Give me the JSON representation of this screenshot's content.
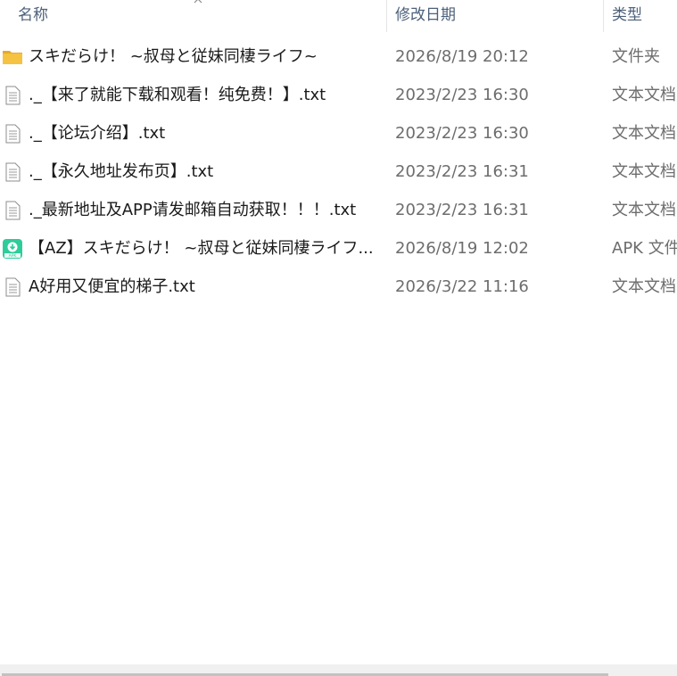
{
  "columns": {
    "name": "名称",
    "date": "修改日期",
    "type": "类型"
  },
  "files": [
    {
      "icon": "folder-icon",
      "name": "スキだらけ！ ~叔母と従妹同棲ライフ~",
      "date": "2026/8/19 20:12",
      "type": "文件夹"
    },
    {
      "icon": "text-file-icon",
      "name": "._【来了就能下载和观看！纯免费！】.txt",
      "date": "2023/2/23 16:30",
      "type": "文本文档"
    },
    {
      "icon": "text-file-icon",
      "name": "._【论坛介绍】.txt",
      "date": "2023/2/23 16:30",
      "type": "文本文档"
    },
    {
      "icon": "text-file-icon",
      "name": "._【永久地址发布页】.txt",
      "date": "2023/2/23 16:31",
      "type": "文本文档"
    },
    {
      "icon": "text-file-icon",
      "name": "._最新地址及APP请发邮箱自动获取！！！.txt",
      "date": "2023/2/23 16:31",
      "type": "文本文档"
    },
    {
      "icon": "apk-file-icon",
      "name": "【AZ】スキだらけ！ ~叔母と従妹同棲ライフ...",
      "date": "2026/8/19 12:02",
      "type": "APK 文件"
    },
    {
      "icon": "text-file-icon",
      "name": "A好用又便宜的梯子.txt",
      "date": "2026/3/22 11:16",
      "type": "文本文档"
    }
  ],
  "colors": {
    "header_text": "#4c607a",
    "folder": "#f5c242",
    "apk": "#2ecc9a",
    "secondary_text": "#6d6d6d"
  }
}
